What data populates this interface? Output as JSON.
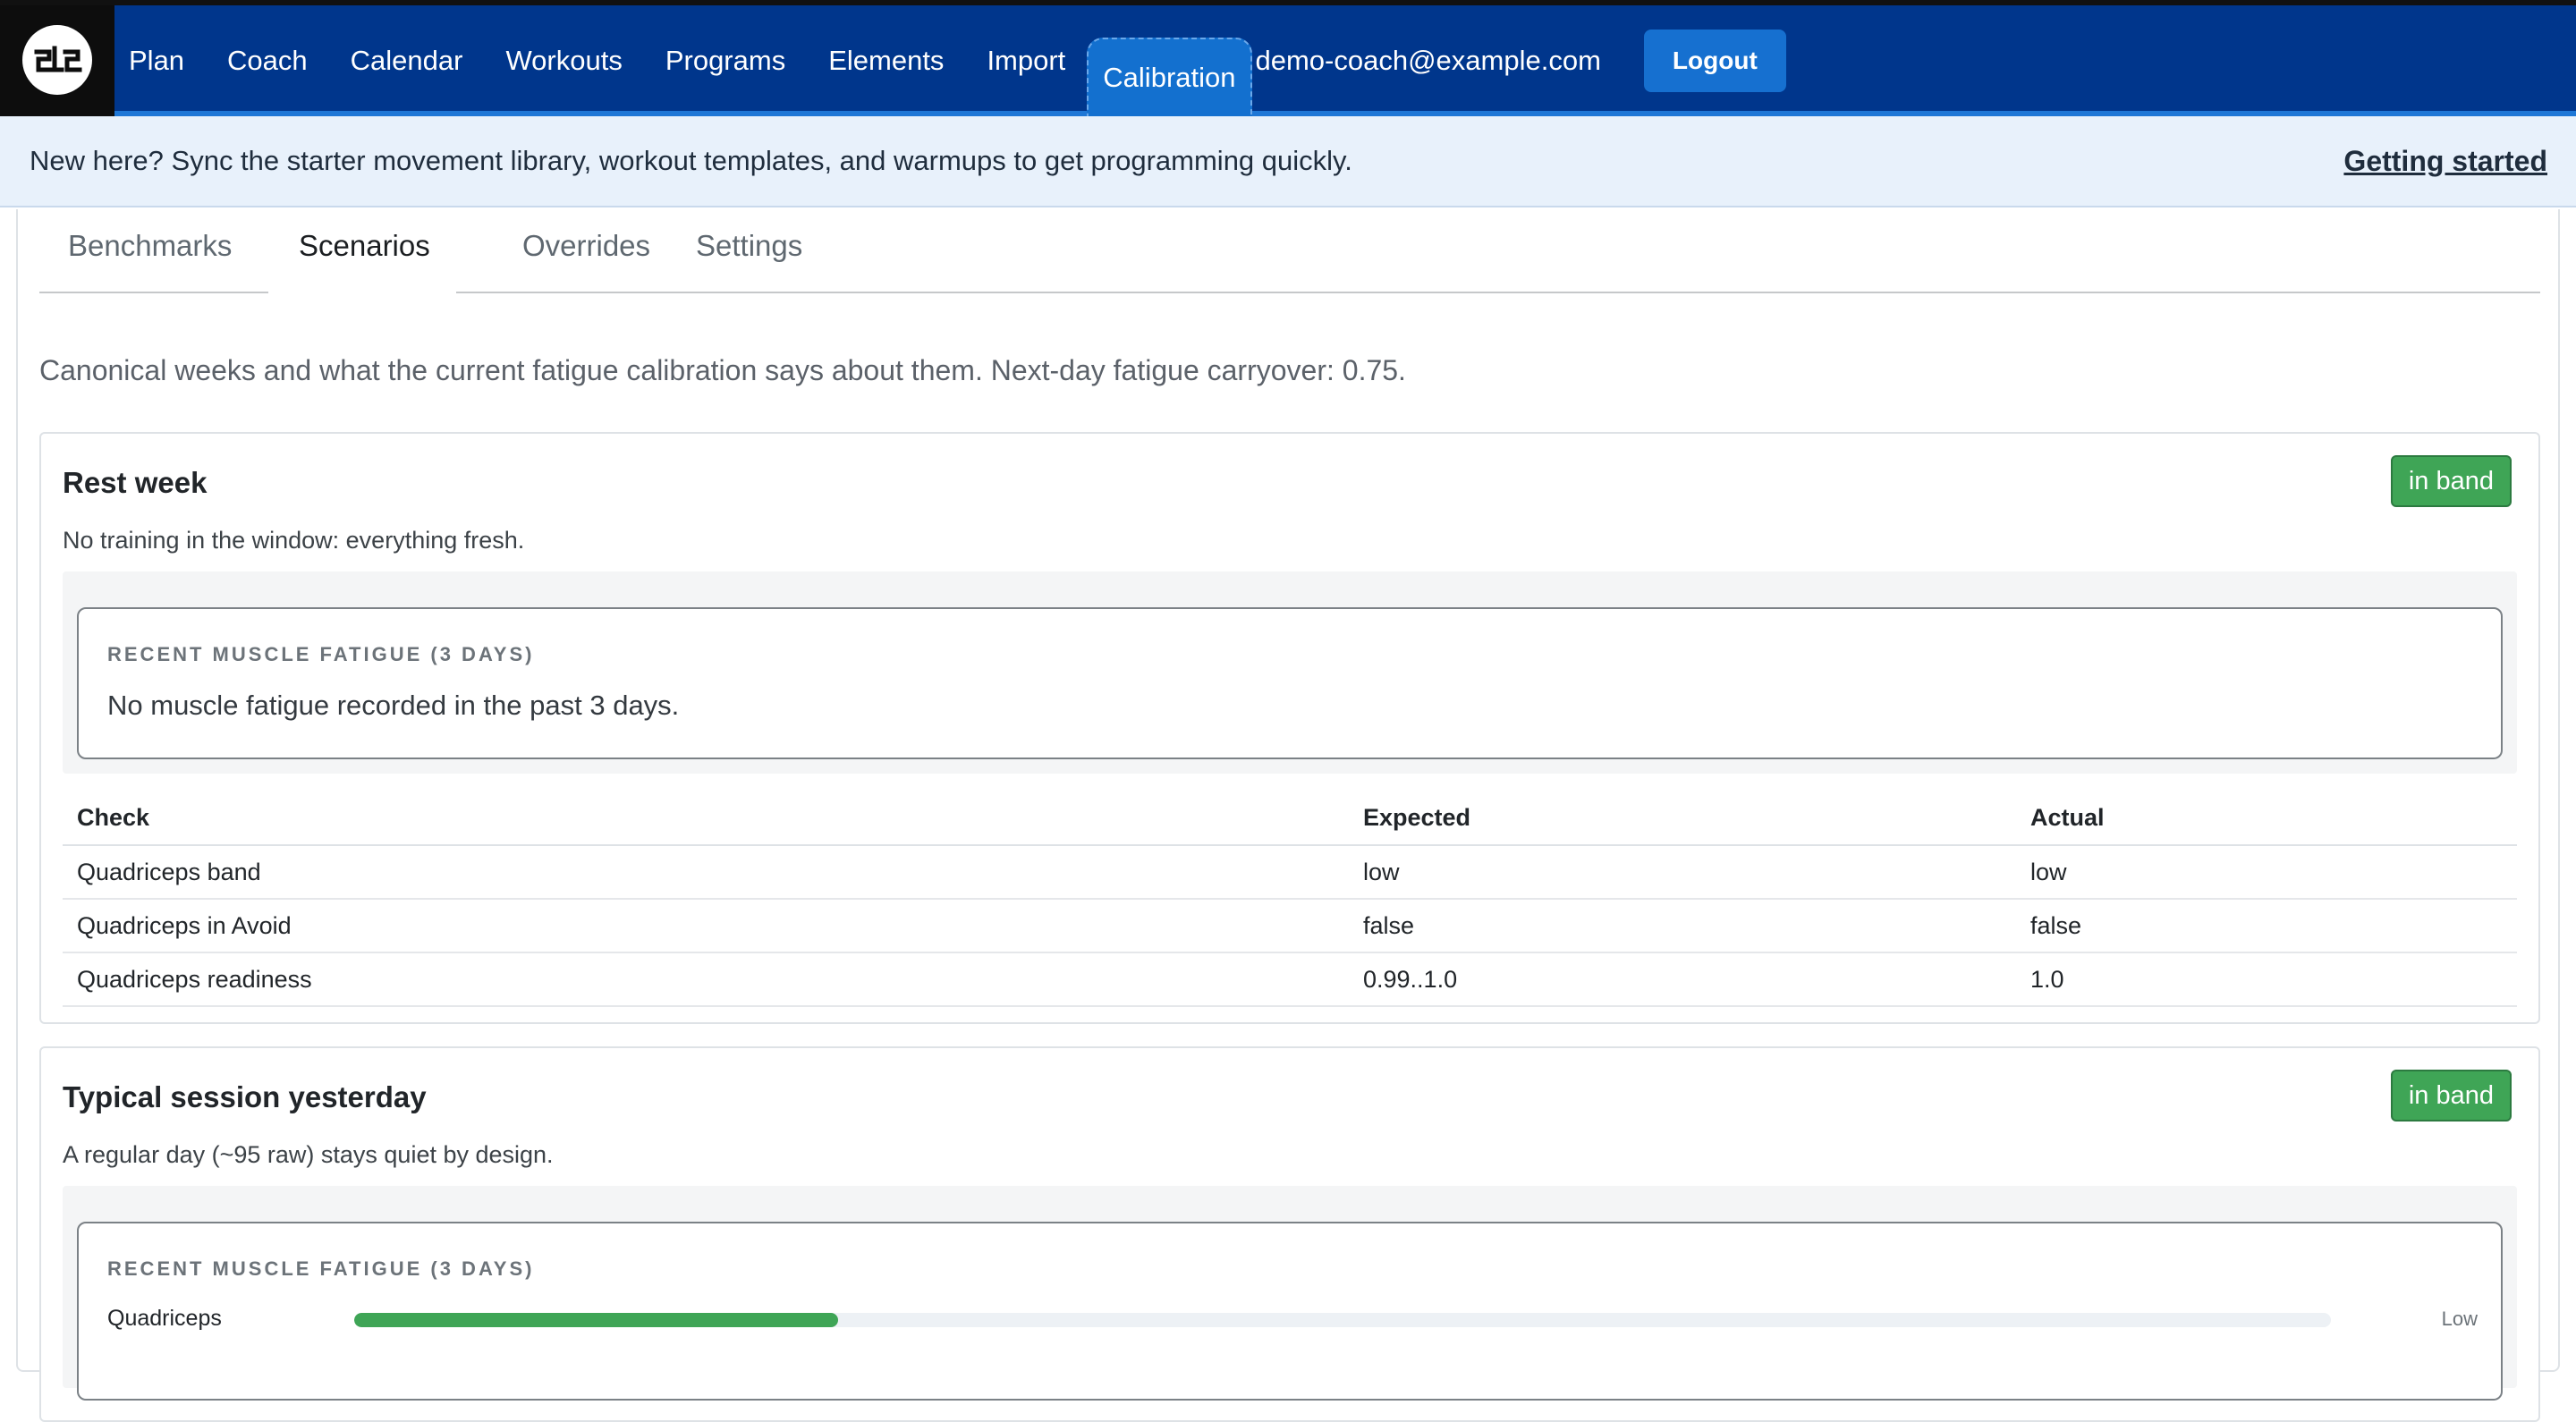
{
  "nav": {
    "items": [
      {
        "label": "Plan",
        "name": "nav-plan"
      },
      {
        "label": "Coach",
        "name": "nav-coach"
      },
      {
        "label": "Calendar",
        "name": "nav-calendar"
      },
      {
        "label": "Workouts",
        "name": "nav-workouts"
      },
      {
        "label": "Programs",
        "name": "nav-programs"
      },
      {
        "label": "Elements",
        "name": "nav-elements"
      },
      {
        "label": "Import",
        "name": "nav-import"
      },
      {
        "label": "Calibration",
        "name": "nav-calibration"
      }
    ],
    "active": "Calibration",
    "user_email": "demo-coach@example.com",
    "logout_label": "Logout"
  },
  "banner": {
    "text": "New here? Sync the starter movement library, workout templates, and warmups to get programming quickly.",
    "link": "Getting started"
  },
  "tabs": [
    "Benchmarks",
    "Scenarios",
    "Overrides",
    "Settings"
  ],
  "active_tab": "Scenarios",
  "intro": "Canonical weeks and what the current fatigue calibration says about them. Next-day fatigue carryover: 0.75.",
  "scenarios": [
    {
      "title": "Rest week",
      "badge": "in band",
      "description": "No training in the window: everything fresh.",
      "fatigue_label": "RECENT MUSCLE FATIGUE (3 DAYS)",
      "fatigue_empty": "No muscle fatigue recorded in the past 3 days.",
      "table": {
        "headers": [
          "Check",
          "Expected",
          "Actual"
        ],
        "rows": [
          [
            "Quadriceps band",
            "low",
            "low"
          ],
          [
            "Quadriceps in Avoid",
            "false",
            "false"
          ],
          [
            "Quadriceps readiness",
            "0.99..1.0",
            "1.0"
          ]
        ]
      }
    },
    {
      "title": "Typical session yesterday",
      "badge": "in band",
      "description": "A regular day (~95 raw) stays quiet by design.",
      "fatigue_label": "RECENT MUSCLE FATIGUE (3 DAYS)",
      "bars": [
        {
          "muscle": "Quadriceps",
          "fill_fraction": 0.245,
          "level": "Low"
        }
      ]
    }
  ],
  "colors": {
    "nav_bg": "#00368c",
    "badge_green": "#3fa556",
    "bar_fill": "#3fa556"
  }
}
